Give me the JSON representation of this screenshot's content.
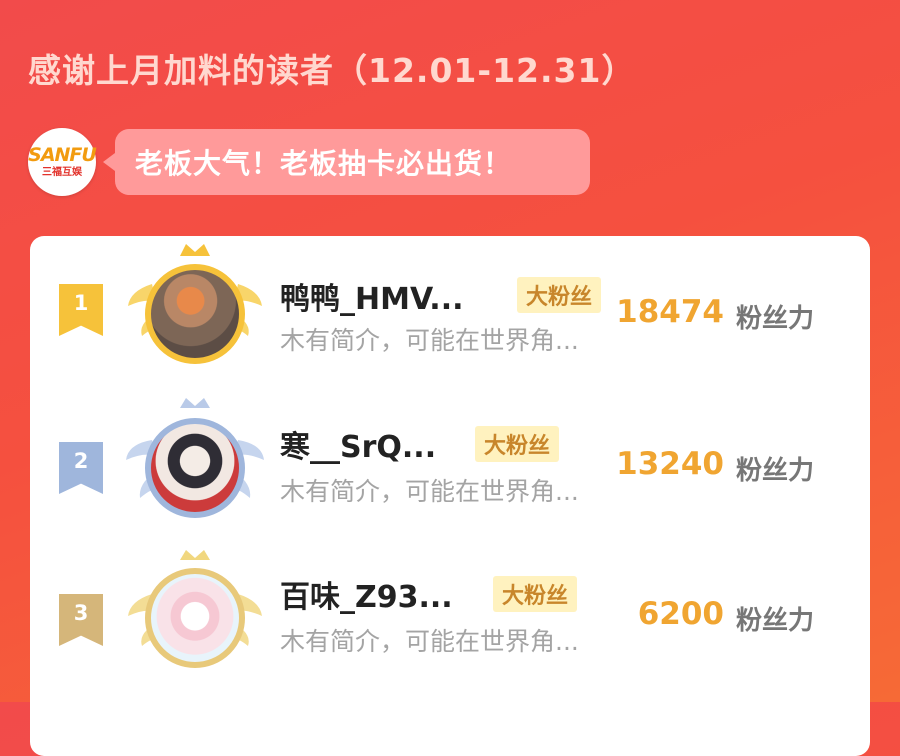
{
  "header": {
    "title": "感谢上月加料的读者（12.01-12.31）"
  },
  "publisher": {
    "logo_text": "SANFU",
    "logo_subtitle": "三福互娱",
    "message": "老板大气！老板抽卡必出货！"
  },
  "leaderboard": [
    {
      "rank": "1",
      "name": "鸭鸭_HMV...",
      "badge": "大粉丝",
      "bio": "木有简介，可能在世界角...",
      "score": "18474",
      "unit": "粉丝力",
      "rank_color": "#f6c23a",
      "frame_color": "#f6c23a"
    },
    {
      "rank": "2",
      "name": "寒__SrQ...",
      "badge": "大粉丝",
      "bio": "木有简介，可能在世界角...",
      "score": "13240",
      "unit": "粉丝力",
      "rank_color": "#9fb6dc",
      "frame_color": "#9fb6dc"
    },
    {
      "rank": "3",
      "name": "百味_Z93...",
      "badge": "大粉丝",
      "bio": "木有简介，可能在世界角...",
      "score": "6200",
      "unit": "粉丝力",
      "rank_color": "#d5b67a",
      "frame_color": "#e8c97a"
    }
  ]
}
